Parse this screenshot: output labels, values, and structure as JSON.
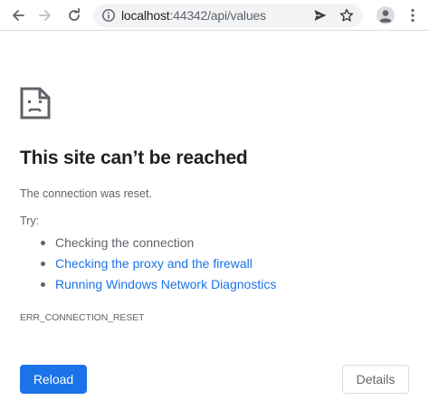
{
  "browser": {
    "url_host": "localhost",
    "url_path": ":44342/api/values",
    "icons": {
      "back": "arrow-left-icon",
      "forward": "arrow-right-icon",
      "reload": "reload-icon",
      "info": "info-icon",
      "share": "send-icon",
      "bookmark": "star-icon",
      "profile": "profile-icon",
      "menu": "kebab-menu-icon"
    }
  },
  "error_page": {
    "icon": "sad-file-icon",
    "title": "This site can’t be reached",
    "description": "The connection was reset.",
    "try_label": "Try:",
    "suggestions": [
      {
        "label": "Checking the connection",
        "is_link": false
      },
      {
        "label": "Checking the proxy and the firewall",
        "is_link": true
      },
      {
        "label": "Running Windows Network Diagnostics",
        "is_link": true
      }
    ],
    "error_code": "ERR_CONNECTION_RESET",
    "reload_label": "Reload",
    "details_label": "Details"
  },
  "colors": {
    "accent": "#1a73e8",
    "text_primary": "#202124",
    "text_secondary": "#5f6368",
    "omnibox_bg": "#f1f3f4"
  }
}
